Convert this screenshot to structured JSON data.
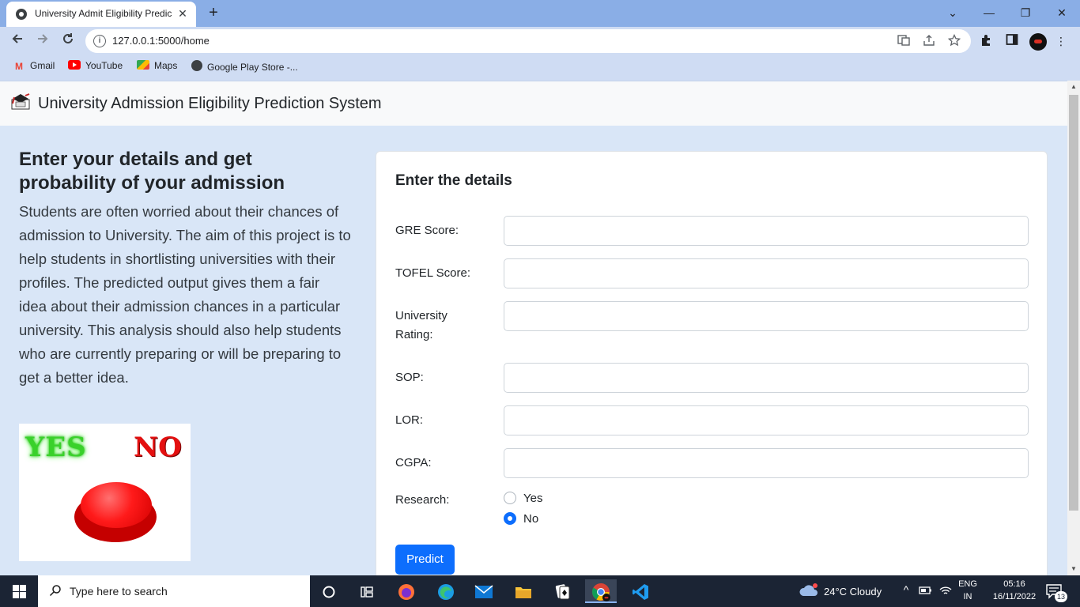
{
  "browser": {
    "tab_title": "University Admit Eligibility Predic",
    "tab_close": "✕",
    "new_tab": "+",
    "url": "127.0.0.1:5000/home",
    "window_controls": {
      "dropdown": "⌄",
      "minimize": "—",
      "restore": "❐",
      "close": "✕"
    },
    "bookmarks": [
      {
        "label": "Gmail",
        "icon": "gmail-icon"
      },
      {
        "label": "YouTube",
        "icon": "youtube-icon"
      },
      {
        "label": "Maps",
        "icon": "maps-icon"
      },
      {
        "label": "Google Play Store -...",
        "icon": "play-store-icon"
      }
    ]
  },
  "page": {
    "brand": "University Admission Eligibility Prediction System",
    "heading": "Enter your details and get probability of your admission",
    "description": "Students are often worried about their chances of admission to University. The aim of this project is to help students in shortlisting universities with their profiles. The predicted output gives them a fair idea about their admission chances in a particular university. This analysis should also help students who are currently preparing or will be preparing to get a better idea.",
    "image": {
      "yes_text": "YES",
      "no_text": "NO"
    },
    "form": {
      "title": "Enter the details",
      "fields": [
        {
          "label": "GRE Score:",
          "value": ""
        },
        {
          "label": "TOFEL Score:",
          "value": ""
        },
        {
          "label": "University Rating:",
          "value": ""
        },
        {
          "label": "SOP:",
          "value": ""
        },
        {
          "label": "LOR:",
          "value": ""
        },
        {
          "label": "CGPA:",
          "value": ""
        }
      ],
      "research_label": "Research:",
      "research_options": [
        {
          "label": "Yes",
          "checked": false
        },
        {
          "label": "No",
          "checked": true
        }
      ],
      "submit_label": "Predict"
    }
  },
  "taskbar": {
    "search_placeholder": "Type here to search",
    "weather": "24°C  Cloudy",
    "language_top": "ENG",
    "language_bottom": "IN",
    "time": "05:16",
    "date": "16/11/2022",
    "notification_count": "13"
  },
  "colors": {
    "primary": "#0d6efd",
    "page_bg": "#d9e6f7",
    "taskbar_bg": "#1b2434",
    "tabbar_bg": "#8aaee6"
  }
}
